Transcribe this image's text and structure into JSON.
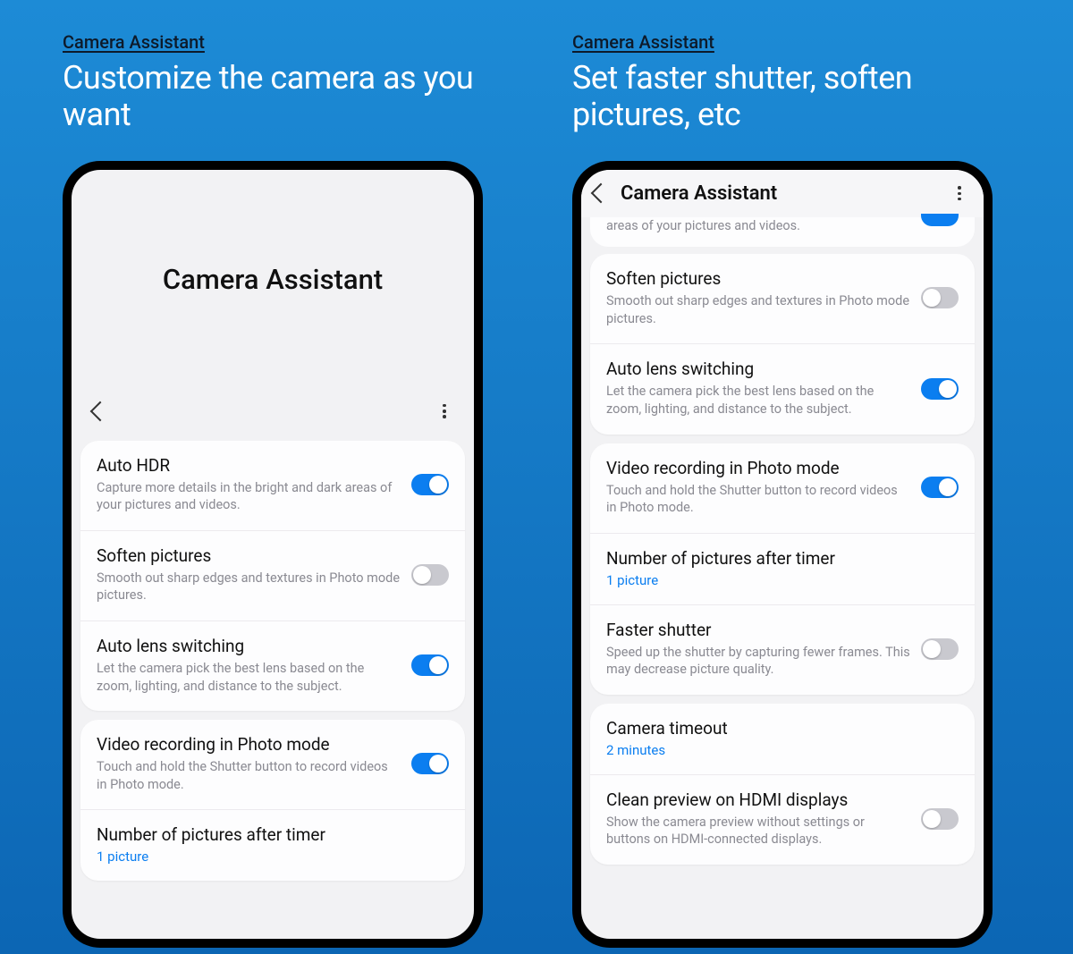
{
  "left": {
    "link": "Camera Assistant",
    "headline": "Customize the camera as you want",
    "bigTitle": "Camera Assistant",
    "rows": {
      "autoHdr": {
        "title": "Auto HDR",
        "desc": "Capture more details in the bright and dark areas of your pictures and videos."
      },
      "soften": {
        "title": "Soften pictures",
        "desc": "Smooth out sharp edges and textures in Photo mode pictures."
      },
      "autoLens": {
        "title": "Auto lens switching",
        "desc": "Let the camera pick the best lens based on the zoom, lighting, and distance to the subject."
      },
      "vidRec": {
        "title": "Video recording in Photo mode",
        "desc": "Touch and hold the Shutter button to record videos in Photo mode."
      },
      "numPics": {
        "title": "Number of pictures after timer",
        "value": "1 picture"
      }
    }
  },
  "right": {
    "link": "Camera Assistant",
    "headline": "Set  faster shutter, soften pictures, etc",
    "toolbarTitle": "Camera Assistant",
    "clippedDesc": "areas of your pictures and videos.",
    "rows": {
      "soften": {
        "title": "Soften pictures",
        "desc": "Smooth out sharp edges and textures in Photo mode pictures."
      },
      "autoLens": {
        "title": "Auto lens switching",
        "desc": "Let the camera pick the best lens based on the zoom, lighting, and distance to the subject."
      },
      "vidRec": {
        "title": "Video recording in Photo mode",
        "desc": "Touch and hold the Shutter button to record videos in Photo mode."
      },
      "numPics": {
        "title": "Number of pictures after timer",
        "value": "1 picture"
      },
      "faster": {
        "title": "Faster shutter",
        "desc": "Speed up the shutter by capturing fewer frames. This may decrease picture quality."
      },
      "timeout": {
        "title": "Camera timeout",
        "value": "2 minutes"
      },
      "clean": {
        "title": "Clean preview on HDMI displays",
        "desc": "Show the camera preview without settings or buttons on HDMI-connected displays."
      }
    }
  }
}
